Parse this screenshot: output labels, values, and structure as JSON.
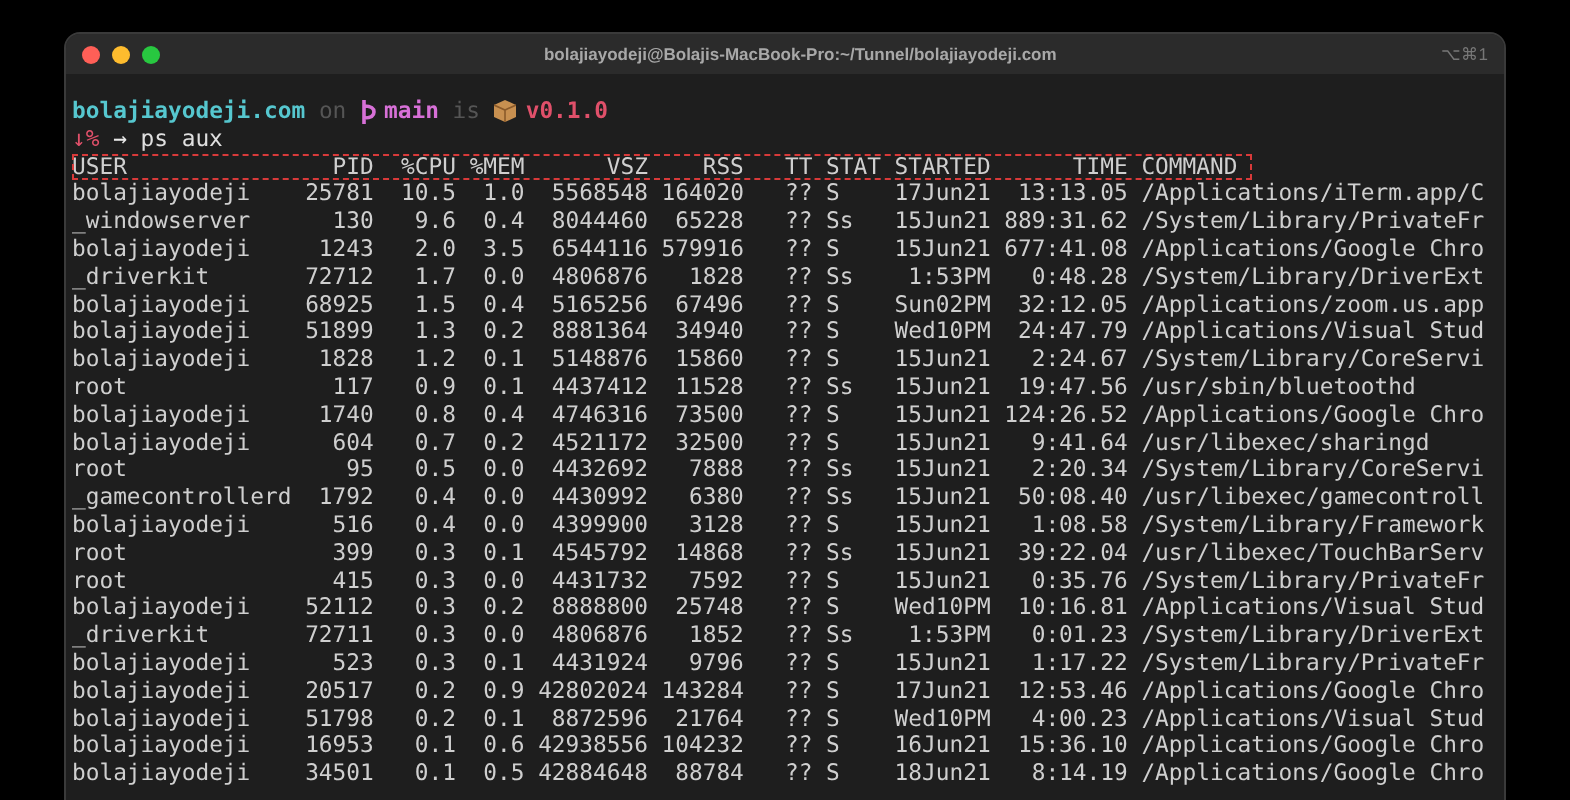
{
  "window": {
    "title": "bolajiayodeji@Bolajis-MacBook-Pro:~/Tunnel/bolajiayodeji.com",
    "shortcut": "⌥⌘1"
  },
  "prompt": {
    "host": "bolajiayodeji.com",
    "on": "on",
    "branch": "main",
    "is": "is",
    "version": "v0.1.0"
  },
  "command": {
    "status": "↓%",
    "arrow": "→",
    "text": "ps aux"
  },
  "table": {
    "columns": [
      "USER",
      "PID",
      "%CPU",
      "%MEM",
      "VSZ",
      "RSS",
      "TT",
      "STAT",
      "STARTED",
      "TIME",
      "COMMAND"
    ],
    "rows": [
      [
        "bolajiayodeji",
        "25781",
        "10.5",
        "1.0",
        "5568548",
        "164020",
        "??",
        "S",
        "17Jun21",
        "13:13.05",
        "/Applications/iTerm.app/C"
      ],
      [
        "_windowserver",
        "130",
        "9.6",
        "0.4",
        "8044460",
        "65228",
        "??",
        "Ss",
        "15Jun21",
        "889:31.62",
        "/System/Library/PrivateFr"
      ],
      [
        "bolajiayodeji",
        "1243",
        "2.0",
        "3.5",
        "6544116",
        "579916",
        "??",
        "S",
        "15Jun21",
        "677:41.08",
        "/Applications/Google Chro"
      ],
      [
        "_driverkit",
        "72712",
        "1.7",
        "0.0",
        "4806876",
        "1828",
        "??",
        "Ss",
        "1:53PM",
        "0:48.28",
        "/System/Library/DriverExt"
      ],
      [
        "bolajiayodeji",
        "68925",
        "1.5",
        "0.4",
        "5165256",
        "67496",
        "??",
        "S",
        "Sun02PM",
        "32:12.05",
        "/Applications/zoom.us.app"
      ],
      [
        "bolajiayodeji",
        "51899",
        "1.3",
        "0.2",
        "8881364",
        "34940",
        "??",
        "S",
        "Wed10PM",
        "24:47.79",
        "/Applications/Visual Stud"
      ],
      [
        "bolajiayodeji",
        "1828",
        "1.2",
        "0.1",
        "5148876",
        "15860",
        "??",
        "S",
        "15Jun21",
        "2:24.67",
        "/System/Library/CoreServi"
      ],
      [
        "root",
        "117",
        "0.9",
        "0.1",
        "4437412",
        "11528",
        "??",
        "Ss",
        "15Jun21",
        "19:47.56",
        "/usr/sbin/bluetoothd"
      ],
      [
        "bolajiayodeji",
        "1740",
        "0.8",
        "0.4",
        "4746316",
        "73500",
        "??",
        "S",
        "15Jun21",
        "124:26.52",
        "/Applications/Google Chro"
      ],
      [
        "bolajiayodeji",
        "604",
        "0.7",
        "0.2",
        "4521172",
        "32500",
        "??",
        "S",
        "15Jun21",
        "9:41.64",
        "/usr/libexec/sharingd"
      ],
      [
        "root",
        "95",
        "0.5",
        "0.0",
        "4432692",
        "7888",
        "??",
        "Ss",
        "15Jun21",
        "2:20.34",
        "/System/Library/CoreServi"
      ],
      [
        "_gamecontrollerd",
        "1792",
        "0.4",
        "0.0",
        "4430992",
        "6380",
        "??",
        "Ss",
        "15Jun21",
        "50:08.40",
        "/usr/libexec/gamecontroll"
      ],
      [
        "bolajiayodeji",
        "516",
        "0.4",
        "0.0",
        "4399900",
        "3128",
        "??",
        "S",
        "15Jun21",
        "1:08.58",
        "/System/Library/Framework"
      ],
      [
        "root",
        "399",
        "0.3",
        "0.1",
        "4545792",
        "14868",
        "??",
        "Ss",
        "15Jun21",
        "39:22.04",
        "/usr/libexec/TouchBarServ"
      ],
      [
        "root",
        "415",
        "0.3",
        "0.0",
        "4431732",
        "7592",
        "??",
        "S",
        "15Jun21",
        "0:35.76",
        "/System/Library/PrivateFr"
      ],
      [
        "bolajiayodeji",
        "52112",
        "0.3",
        "0.2",
        "8888800",
        "25748",
        "??",
        "S",
        "Wed10PM",
        "10:16.81",
        "/Applications/Visual Stud"
      ],
      [
        "_driverkit",
        "72711",
        "0.3",
        "0.0",
        "4806876",
        "1852",
        "??",
        "Ss",
        "1:53PM",
        "0:01.23",
        "/System/Library/DriverExt"
      ],
      [
        "bolajiayodeji",
        "523",
        "0.3",
        "0.1",
        "4431924",
        "9796",
        "??",
        "S",
        "15Jun21",
        "1:17.22",
        "/System/Library/PrivateFr"
      ],
      [
        "bolajiayodeji",
        "20517",
        "0.2",
        "0.9",
        "42802024",
        "143284",
        "??",
        "S",
        "17Jun21",
        "12:53.46",
        "/Applications/Google Chro"
      ],
      [
        "bolajiayodeji",
        "51798",
        "0.2",
        "0.1",
        "8872596",
        "21764",
        "??",
        "S",
        "Wed10PM",
        "4:00.23",
        "/Applications/Visual Stud"
      ],
      [
        "bolajiayodeji",
        "16953",
        "0.1",
        "0.6",
        "42938556",
        "104232",
        "??",
        "S",
        "16Jun21",
        "15:36.10",
        "/Applications/Google Chro"
      ],
      [
        "bolajiayodeji",
        "34501",
        "0.1",
        "0.5",
        "42884648",
        "88784",
        "??",
        "S",
        "18Jun21",
        "8:14.19",
        "/Applications/Google Chro"
      ]
    ]
  }
}
